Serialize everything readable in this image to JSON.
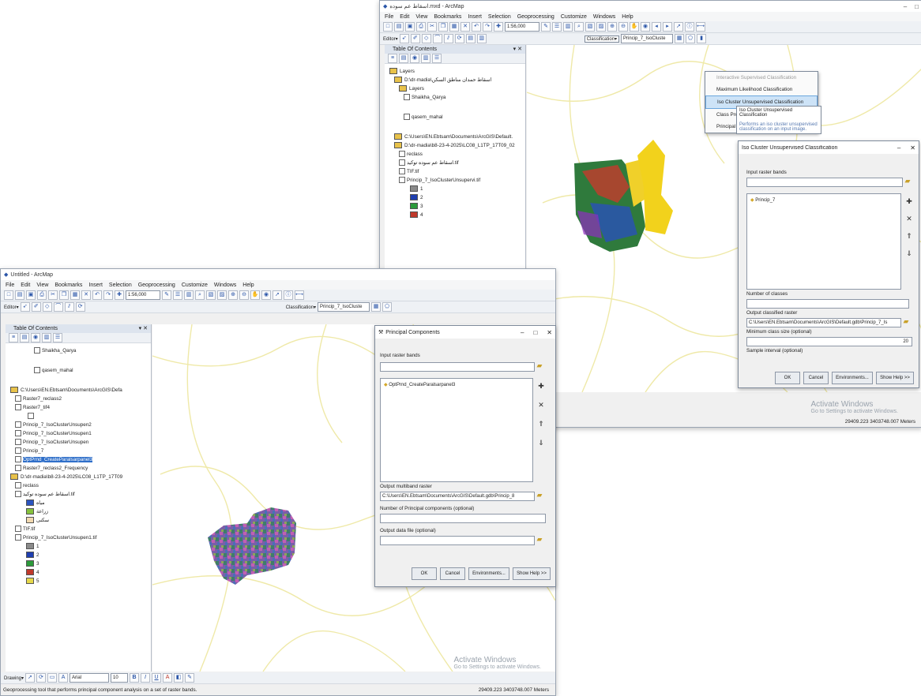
{
  "app": {
    "title_back": "اسقاط عم سوده.mxd - ArcMap",
    "title_front": "Untitled - ArcMap",
    "menu": [
      "File",
      "Edit",
      "View",
      "Bookmarks",
      "Insert",
      "Selection",
      "Geoprocessing",
      "Customize",
      "Windows",
      "Help"
    ],
    "scale": "1:56,000",
    "editor_label": "Editor▾",
    "classification_label": "Classification▾",
    "layer_combo": "Princip_7_IsoCluste"
  },
  "back_window": {
    "toc_title": "Table Of Contents",
    "toc_rows": [
      "Layers",
      "D:\\dr-madia\\اسقاط حمدان مناطق السكن",
      "Layers",
      "Shaikha_Qarya",
      "qasem_mahal",
      "C:\\Users\\EN.Ebtsam\\Documents\\ArcGIS\\Default.",
      "D:\\dr-madia\\b8-23-4-2025\\LC08_L1TP_17T09_02",
      "reclass",
      "اسقاط عم سوده توكيد.tif",
      "TIF.tif",
      "Princip_7_IsoClusterUnsupervi.tif"
    ],
    "classes": [
      "1",
      "2",
      "3",
      "4"
    ],
    "class_colors": [
      "#8a8a8a",
      "#1f3fb0",
      "#2b9a3a",
      "#c0392b"
    ],
    "dropdown": [
      "Interactive Supervised Classification",
      "Maximum Likelihood Classification",
      "Iso Cluster Unsupervised Classification",
      "Class Probability",
      "Principal Components"
    ],
    "tooltip_title": "Iso Cluster Unsupervised Classification",
    "tooltip_body": "Performs an iso cluster unsupervised classification on an input image.",
    "iso_dialog": {
      "title": "Iso Cluster Unsupervised Classification",
      "input_label": "Input raster bands",
      "item": "Princip_7",
      "classes_label": "Number of classes",
      "output_label": "Output classified raster",
      "output_value": "C:\\Users\\EN.Ebtsam\\Documents\\ArcGIS\\Default.gdb\\Princip_7_Is",
      "min_label": "Minimum class size (optional)",
      "min_value": "20",
      "interval_label": "Sample interval (optional)",
      "ok": "OK",
      "cancel": "Cancel",
      "env": "Environments...",
      "help": "Show Help >>"
    },
    "status_coords": "29409.223  3403748.007 Meters",
    "watermark_title": "Activate Windows",
    "watermark_sub": "Go to Settings to activate Windows."
  },
  "front_window": {
    "toc_title": "Table Of Contents",
    "toc_rows": [
      "Shaikha_Qarya",
      "qasem_mahal",
      "C:\\Users\\EN.Ebtsam\\Documents\\ArcGIS\\Defa",
      "Raster7_reclass2",
      "Raster7_tif4",
      "",
      "Princip_7_IsoClusterUnsupen2",
      "Princip_7_IsoClusterUnsupen1",
      "Princip_7_IsoClusterUnsupen",
      "Princip_7",
      "OptPrnd_CreateParalsarpanel3",
      "Raster7_reclass2_Frequency",
      "D:\\dr-madia\\b8-23-4-2025\\LC08_L1TP_17T09",
      "reclass",
      "اسقاط عم سوده توكيد.tif",
      "TIF.tif",
      "Princip_7_IsoClusterUnsupen1.tif"
    ],
    "legend_classes": [
      "مياه",
      "زراعة",
      "سكنى"
    ],
    "legend_colors": [
      "#2b54c0",
      "#86c23c",
      "#f2d9b0"
    ],
    "classes": [
      "1",
      "2",
      "3",
      "4",
      "5"
    ],
    "class_colors": [
      "#8a8a8a",
      "#1f3fb0",
      "#2b9a3a",
      "#c0392b",
      "#e6d84a"
    ],
    "pca_dialog": {
      "title": "Principal Components",
      "input_label": "Input raster bands",
      "item": "OptPrnd_CreateParalsarpanel3",
      "output_label": "Output multiband raster",
      "output_value": "C:\\Users\\EN.Ebtsam\\Documents\\ArcGIS\\Default.gdb\\Princip_8",
      "num_label": "Number of Principal components (optional)",
      "datafile_label": "Output data file (optional)",
      "ok": "OK",
      "cancel": "Cancel",
      "env": "Environments...",
      "help": "Show Help >>"
    },
    "drawing_label": "Drawing▾",
    "font_name": "Arial",
    "font_size": "10",
    "status_text": "Geoprocessing tool that performs principal component analysis on a set of raster bands.",
    "status_coords": "29409.223  3403748.007 Meters",
    "watermark_title": "Activate Windows",
    "watermark_sub": "Go to Settings to activate Windows."
  }
}
